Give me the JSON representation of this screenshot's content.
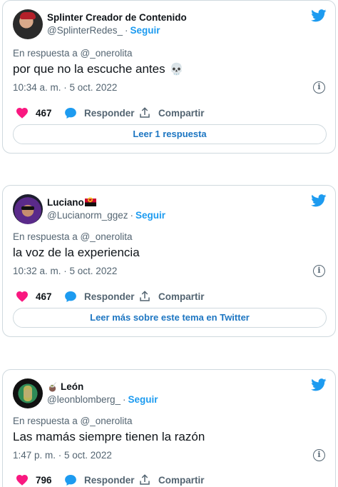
{
  "colors": {
    "accent": "#1d9bf0",
    "like": "#f91880",
    "muted": "#536471"
  },
  "tweets": [
    {
      "display_name": "Splinter Creador de Contenido",
      "handle": "@SplinterRedes_",
      "follow_label": "Seguir",
      "reply_to": "En respuesta a @_onerolita",
      "text": "por que no la escuche antes",
      "emoji": "💀",
      "time": "10:34 a. m. · 5 oct. 2022",
      "likes": "467",
      "reply_label": "Responder",
      "share_label": "Compartir",
      "cta": "Leer 1 respuesta"
    },
    {
      "display_name": "Luciano",
      "handle": "@Lucianorm_ggez",
      "follow_label": "Seguir",
      "reply_to": "En respuesta a @_onerolita",
      "text": "la voz de la experiencia",
      "time": "10:32 a. m. · 5 oct. 2022",
      "likes": "467",
      "reply_label": "Responder",
      "share_label": "Compartir",
      "cta": "Leer más sobre este tema en Twitter"
    },
    {
      "display_name": "León",
      "name_emoji": "🧉",
      "handle": "@leonblomberg_",
      "follow_label": "Seguir",
      "reply_to": "En respuesta a @_onerolita",
      "text": "Las mamás siempre tienen la razón",
      "time": "1:47 p. m. · 5 oct. 2022",
      "likes": "796",
      "reply_label": "Responder",
      "share_label": "Compartir"
    }
  ]
}
